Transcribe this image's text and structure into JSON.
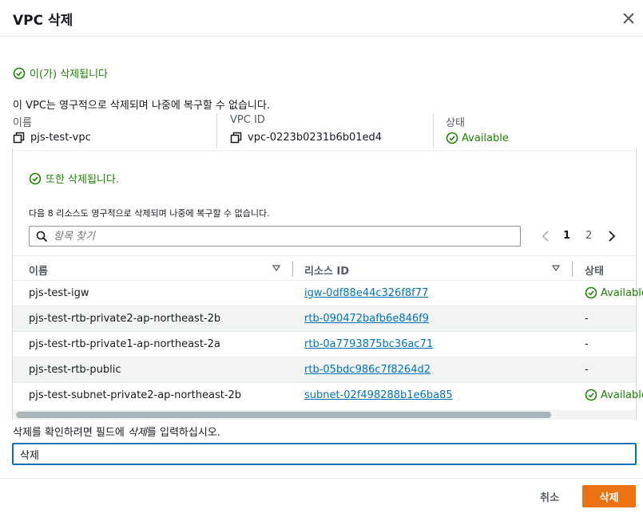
{
  "dialog": {
    "title": "VPC 삭제",
    "deleted_notice": "이(가) 삭제됩니다",
    "warning": "이 VPC는 영구적으로 삭제되며 나중에 복구할 수 없습니다."
  },
  "vpc": {
    "name_label": "이름",
    "name_value": "pjs-test-vpc",
    "id_label": "VPC ID",
    "id_value": "vpc-0223b0231b6b01ed4",
    "state_label": "상태",
    "state_value": "Available"
  },
  "resources": {
    "also_deleted": "또한 삭제됩니다.",
    "description": "다음 8 리소스도 영구적으로 삭제되며 나중에 복구할 수 없습니다.",
    "search_placeholder": "항목 찾기",
    "pagination": {
      "current": "1",
      "next": "2"
    },
    "columns": {
      "name": "이름",
      "resource_id": "리소스 ID",
      "state": "상태"
    },
    "rows": [
      {
        "name": "pjs-test-igw",
        "id": "igw-0df88e44c326f8f77",
        "state": "Available"
      },
      {
        "name": "pjs-test-rtb-private2-ap-northeast-2b",
        "id": "rtb-090472bafb6e846f9",
        "state": "-"
      },
      {
        "name": "pjs-test-rtb-private1-ap-northeast-2a",
        "id": "rtb-0a7793875bc36ac71",
        "state": "-"
      },
      {
        "name": "pjs-test-rtb-public",
        "id": "rtb-05bdc986c7f8264d2",
        "state": "-"
      },
      {
        "name": "pjs-test-subnet-private2-ap-northeast-2b",
        "id": "subnet-02f498288b1e6ba85",
        "state": "Available"
      }
    ]
  },
  "confirm": {
    "label_prefix": "삭제를 확인하려면 필드에 ",
    "label_keyword": "삭제",
    "label_suffix": "를 입력하십시오.",
    "input_value": "삭제"
  },
  "footer": {
    "cancel_label": "취소",
    "delete_label": "삭제"
  },
  "colors": {
    "success": "#1d8102",
    "link": "#0073bb",
    "primary_button": "#ec7211"
  }
}
